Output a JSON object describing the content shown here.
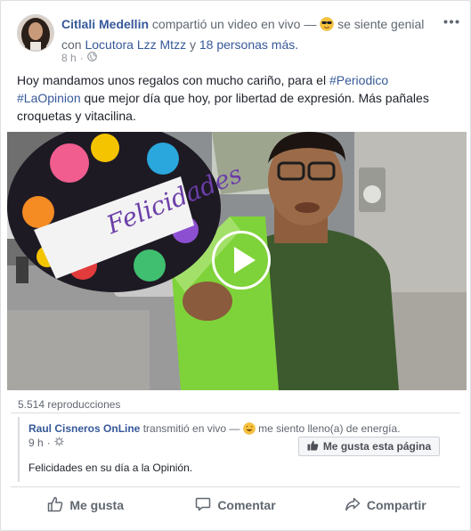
{
  "post": {
    "author": "Citlali Medellin",
    "action_text": "compartió un video en vivo —",
    "feeling": "se siente genial",
    "with_text": "con",
    "tagged": "Locutora Lzz Mtzz",
    "and_text": "y",
    "others": "18 personas más.",
    "time": "8 h",
    "text_before": "Hoy mandamos unos regalos con mucho cariño, para el",
    "hashtag1": "#Periodico",
    "hashtag2": "#LaOpinion",
    "text_after": "que mejor día que hoy, por libertad de expresión. Más pañales croquetas y vitacilina.",
    "views": "5.514 reproducciones"
  },
  "video": {
    "balloon_text": "Felicidades"
  },
  "shared": {
    "page_name": "Raul Cisneros OnLine",
    "action_text": "transmitió en vivo —",
    "feeling": "me siento lleno(a) de energía.",
    "time": "9 h",
    "like_page_label": "Me gusta esta página",
    "text": "Felicidades en su día a la Opinión."
  },
  "actions": {
    "like": "Me gusta",
    "comment": "Comentar",
    "share": "Compartir"
  },
  "icons": [
    "more-options-icon",
    "globe-icon",
    "sunglasses-emoji-icon",
    "energy-emoji-icon",
    "gear-icon",
    "thumbs-up-icon",
    "comment-icon",
    "share-icon",
    "play-icon"
  ],
  "colors": {
    "link": "#365899",
    "text": "#1d2129",
    "muted": "#606770"
  }
}
